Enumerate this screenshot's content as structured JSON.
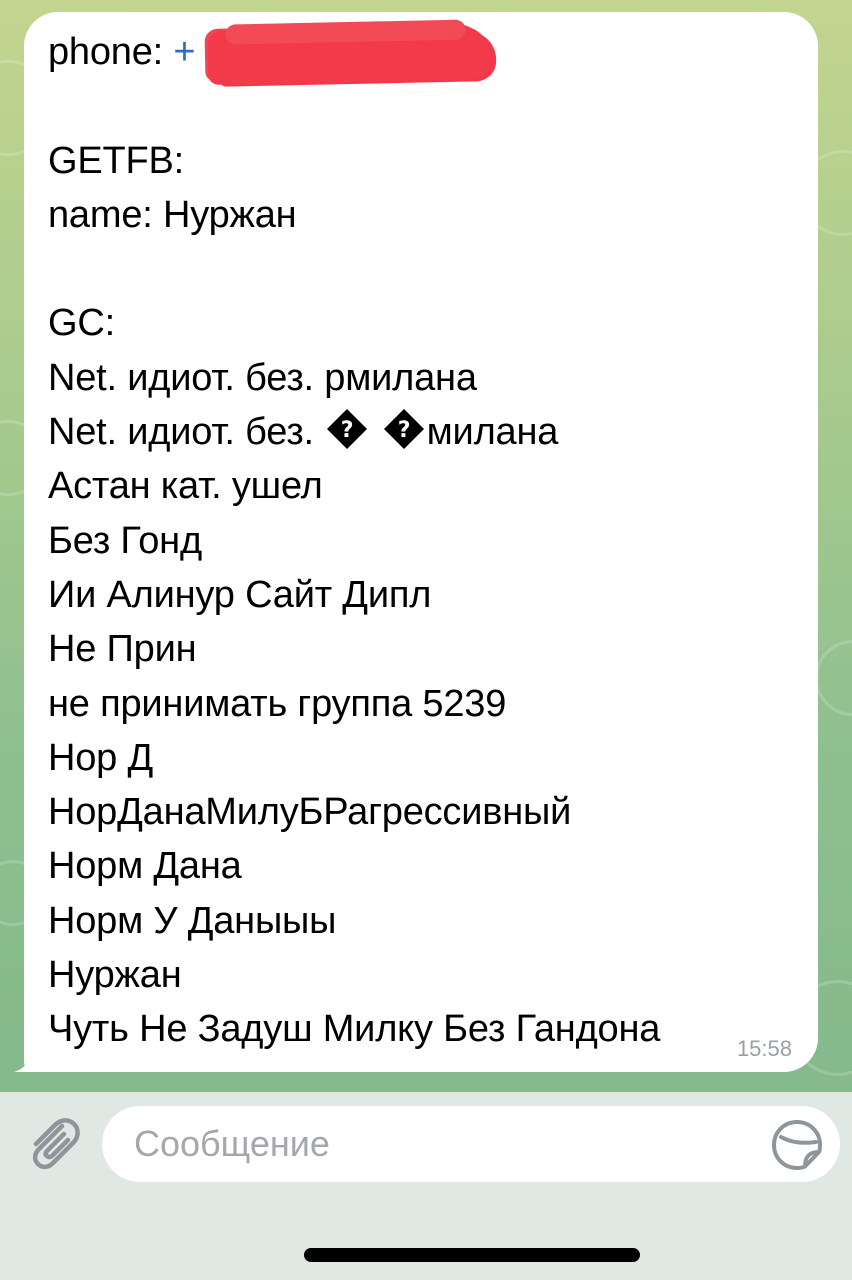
{
  "message": {
    "phone_label": "phone: ",
    "phone_prefix": "+",
    "lines": [
      "",
      "",
      "GETFB:",
      "name: Нуржан",
      "",
      "GC:",
      "Net. идиот. без. рмилана",
      "Net. идиот. без.",
      "Астан кат. ушел",
      "Без Гонд",
      "Ии Алинур Сайт Дипл",
      "Не Прин",
      "не принимать группа 5239",
      "Нор Д",
      "НорДанаМилуБРагрессивный",
      "Норм Дана",
      "Норм У Даныыы",
      "Нуржан",
      "Чуть Не Задуш Милку Без Гандона"
    ],
    "line_8_suffix": "милана",
    "timestamp": "15:58"
  },
  "composer": {
    "placeholder": "Сообщение"
  },
  "icons": {
    "attach": "paperclip-icon",
    "sticker": "sticker-icon",
    "replacement_char": "replacement-character-icon"
  },
  "colors": {
    "link": "#2f6fbf",
    "redaction": "#f23a4a",
    "bubble": "#ffffff",
    "composer_bg": "#dfe8e3"
  }
}
